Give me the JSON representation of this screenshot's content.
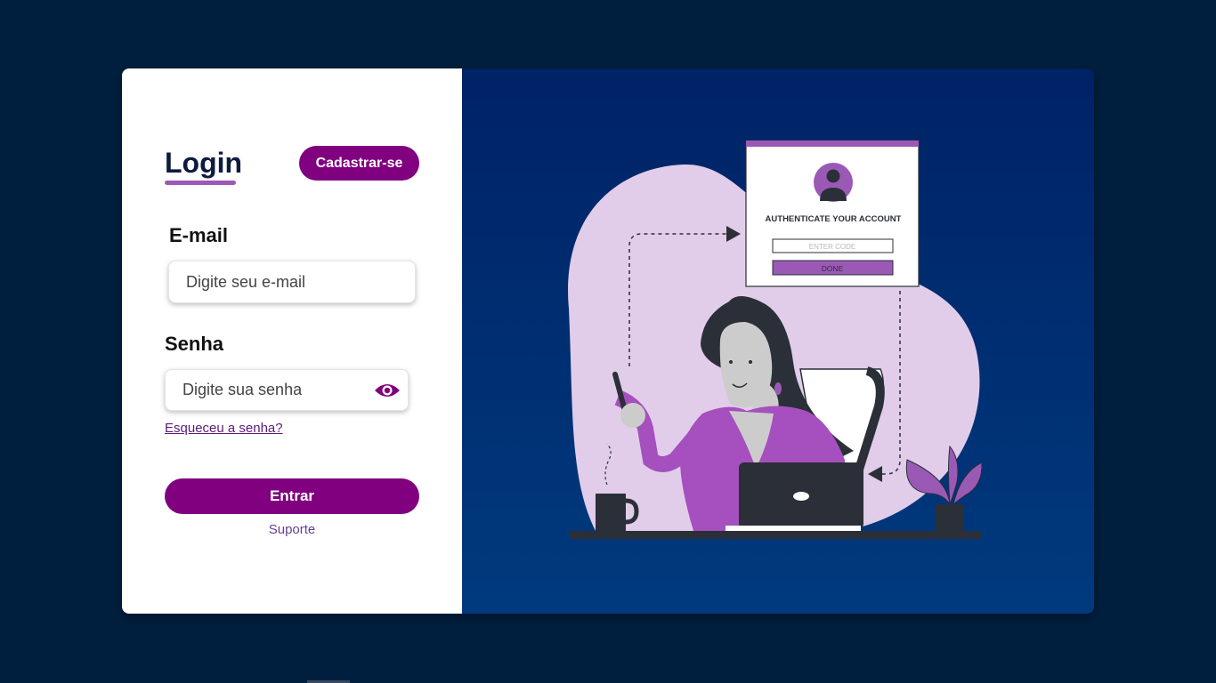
{
  "login": {
    "title": "Login",
    "signup_label": "Cadastrar-se",
    "email_label": "E-mail",
    "email_placeholder": "Digite seu e-mail",
    "password_label": "Senha",
    "password_placeholder": "Digite sua senha",
    "forgot_label": "Esqueceu a senha?",
    "enter_label": "Entrar",
    "support_label": "Suporte"
  },
  "illustration": {
    "auth_title": "AUTHENTICATE YOUR ACCOUNT",
    "code_placeholder": "ENTER CODE",
    "done_label": "DONE"
  },
  "colors": {
    "background": "#001f3f",
    "accent": "#800080",
    "accent_light": "#9b59b6",
    "blob": "#e1cde9"
  },
  "icons": {
    "password_toggle": "eye-icon",
    "avatar": "user-avatar-icon"
  }
}
